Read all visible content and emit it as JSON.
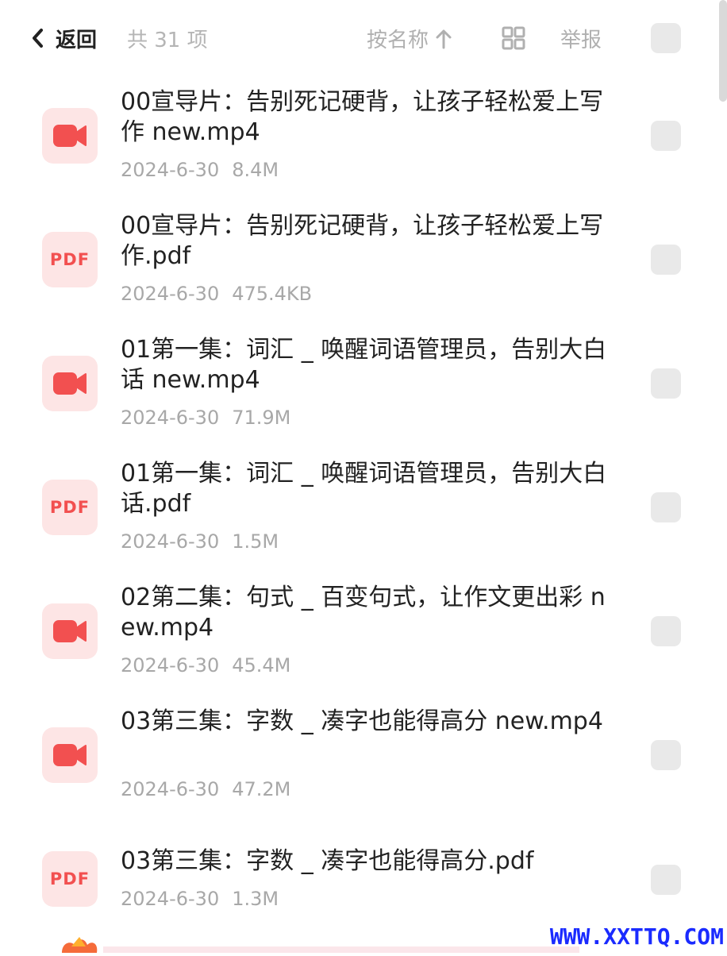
{
  "header": {
    "back_label": "返回",
    "count_label": "共 31 项",
    "sort_label": "按名称",
    "report_label": "举报"
  },
  "files": [
    {
      "name": "00宣导片：告别死记硬背，让孩子轻松爱上写作 new.mp4",
      "date": "2024-6-30",
      "size": "8.4M",
      "type": "video",
      "icon": "video-camera-icon"
    },
    {
      "name": "00宣导片：告别死记硬背，让孩子轻松爱上写作.pdf",
      "date": "2024-6-30",
      "size": "475.4KB",
      "type": "pdf",
      "icon_text": "PDF"
    },
    {
      "name": "01第一集：词汇 _ 唤醒词语管理员，告别大白话 new.mp4",
      "date": "2024-6-30",
      "size": "71.9M",
      "type": "video",
      "icon": "video-camera-icon"
    },
    {
      "name": "01第一集：词汇 _ 唤醒词语管理员，告别大白话.pdf",
      "date": "2024-6-30",
      "size": "1.5M",
      "type": "pdf",
      "icon_text": "PDF"
    },
    {
      "name": "02第二集：句式 _ 百变句式，让作文更出彩 new.mp4",
      "date": "2024-6-30",
      "size": "45.4M",
      "type": "video",
      "icon": "video-camera-icon"
    },
    {
      "name": "03第三集：字数 _ 凑字也能得高分 new.mp4",
      "date": "2024-6-30",
      "size": "47.2M",
      "type": "video",
      "icon": "video-camera-icon"
    },
    {
      "name": "03第三集：字数 _ 凑字也能得高分.pdf",
      "date": "2024-6-30",
      "size": "1.3M",
      "type": "pdf",
      "icon_text": "PDF"
    }
  ],
  "watermark": "WWW.XXTTQ.COM",
  "colors": {
    "accent_red": "#f25050",
    "icon_bg": "#fde5e5",
    "watermark_blue": "#1a2bff"
  }
}
